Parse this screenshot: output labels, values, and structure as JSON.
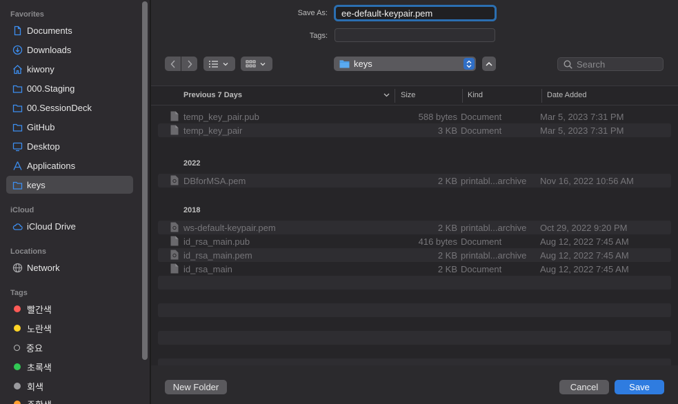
{
  "sidebar": {
    "favorites_title": "Favorites",
    "favorites": [
      {
        "label": "Documents",
        "icon": "document-icon"
      },
      {
        "label": "Downloads",
        "icon": "download-icon"
      },
      {
        "label": "kiwony",
        "icon": "home-icon"
      },
      {
        "label": "000.Staging",
        "icon": "folder-icon"
      },
      {
        "label": "00.SessionDeck",
        "icon": "folder-icon"
      },
      {
        "label": "GitHub",
        "icon": "folder-icon"
      },
      {
        "label": "Desktop",
        "icon": "desktop-icon"
      },
      {
        "label": "Applications",
        "icon": "applications-icon"
      },
      {
        "label": "keys",
        "icon": "folder-icon",
        "selected": true
      }
    ],
    "icloud_title": "iCloud",
    "icloud": [
      {
        "label": "iCloud Drive",
        "icon": "cloud-icon"
      }
    ],
    "locations_title": "Locations",
    "locations": [
      {
        "label": "Network",
        "icon": "globe-icon"
      }
    ],
    "tags_title": "Tags",
    "tags": [
      {
        "label": "빨간색",
        "color": "#ff5b57"
      },
      {
        "label": "노란색",
        "color": "#ffd426"
      },
      {
        "label": "중요",
        "color": "hollow"
      },
      {
        "label": "초록색",
        "color": "#31c854"
      },
      {
        "label": "회색",
        "color": "#9a9a9e"
      },
      {
        "label": "주황색",
        "color": "#ff9f2e"
      }
    ]
  },
  "form": {
    "save_as_label": "Save As:",
    "save_as_value": "ee-default-keypair.pem",
    "tags_label": "Tags:",
    "tags_value": ""
  },
  "toolbar": {
    "location": "keys",
    "search_placeholder": "Search"
  },
  "columns": {
    "name": "Previous 7 Days",
    "size": "Size",
    "kind": "Kind",
    "date": "Date Added"
  },
  "groups": [
    {
      "title": "",
      "files": [
        {
          "name": "temp_key_pair.pub",
          "size": "588 bytes",
          "kind": "Document",
          "date": "Mar 5, 2023 7:31 PM"
        },
        {
          "name": "temp_key_pair",
          "size": "3 KB",
          "kind": "Document",
          "date": "Mar 5, 2023 7:31 PM"
        }
      ]
    },
    {
      "title": "2022",
      "files": [
        {
          "name": "DBforMSA.pem",
          "size": "2 KB",
          "kind": "printabl...archive",
          "date": "Nov 16, 2022 10:56 AM"
        }
      ]
    },
    {
      "title": "2018",
      "files": [
        {
          "name": "ws-default-keypair.pem",
          "size": "2 KB",
          "kind": "printabl...archive",
          "date": "Oct 29, 2022 9:20 PM"
        },
        {
          "name": "id_rsa_main.pub",
          "size": "416 bytes",
          "kind": "Document",
          "date": "Aug 12, 2022 7:45 AM"
        },
        {
          "name": "id_rsa_main.pem",
          "size": "2 KB",
          "kind": "printabl...archive",
          "date": "Aug 12, 2022 7:45 AM"
        },
        {
          "name": "id_rsa_main",
          "size": "2 KB",
          "kind": "Document",
          "date": "Aug 12, 2022 7:45 AM"
        }
      ]
    }
  ],
  "buttons": {
    "new_folder": "New Folder",
    "cancel": "Cancel",
    "save": "Save"
  },
  "colors": {
    "accent": "#2f7ce0",
    "focus_ring": "#2b6fb1",
    "folder_blue": "#5aaaf0"
  }
}
